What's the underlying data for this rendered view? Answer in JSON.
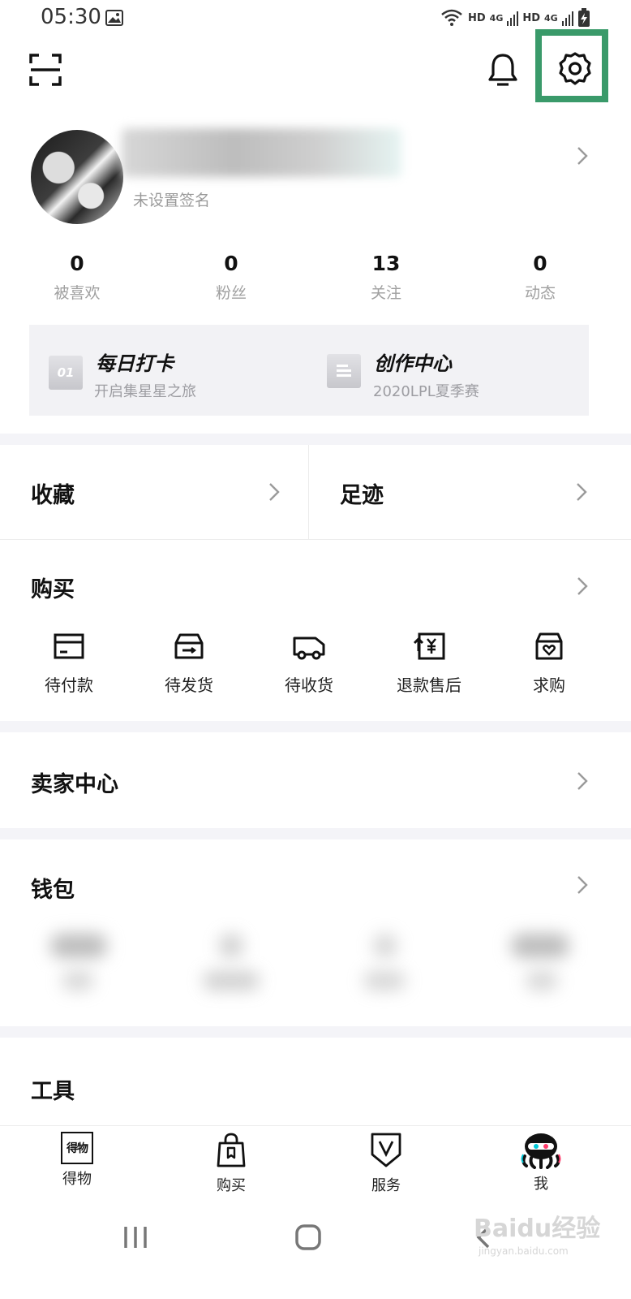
{
  "status_bar": {
    "time": "05:30",
    "network_1": "HD",
    "network_2": "4G",
    "network_3": "HD",
    "network_4": "4G"
  },
  "header": {
    "scan_icon": "scan-icon",
    "bell_icon": "bell-icon",
    "settings_icon": "gear-icon"
  },
  "profile": {
    "signature": "未设置签名"
  },
  "stats": [
    {
      "value": "0",
      "label": "被喜欢"
    },
    {
      "value": "0",
      "label": "粉丝"
    },
    {
      "value": "13",
      "label": "关注"
    },
    {
      "value": "0",
      "label": "动态"
    }
  ],
  "promos": [
    {
      "title": "每日打卡",
      "subtitle": "开启集星星之旅",
      "icon_text": "01"
    },
    {
      "title": "创作中心",
      "subtitle": "2020LPL夏季赛"
    }
  ],
  "quick": {
    "favorites": "收藏",
    "footprints": "足迹"
  },
  "purchase": {
    "title": "购买",
    "items": [
      {
        "label": "待付款",
        "icon": "card-icon"
      },
      {
        "label": "待发货",
        "icon": "box-icon"
      },
      {
        "label": "待收货",
        "icon": "truck-icon"
      },
      {
        "label": "退款售后",
        "icon": "refund-icon"
      },
      {
        "label": "求购",
        "icon": "bag-heart-icon"
      }
    ]
  },
  "seller": {
    "title": "卖家中心"
  },
  "wallet": {
    "title": "钱包"
  },
  "tools": {
    "title": "工具"
  },
  "bottom_nav": [
    {
      "label": "得物",
      "icon_text": "得物"
    },
    {
      "label": "购买"
    },
    {
      "label": "服务"
    },
    {
      "label": "我"
    }
  ],
  "watermark": {
    "text": "Baidu经验",
    "sub": "jingyan.baidu.com"
  }
}
